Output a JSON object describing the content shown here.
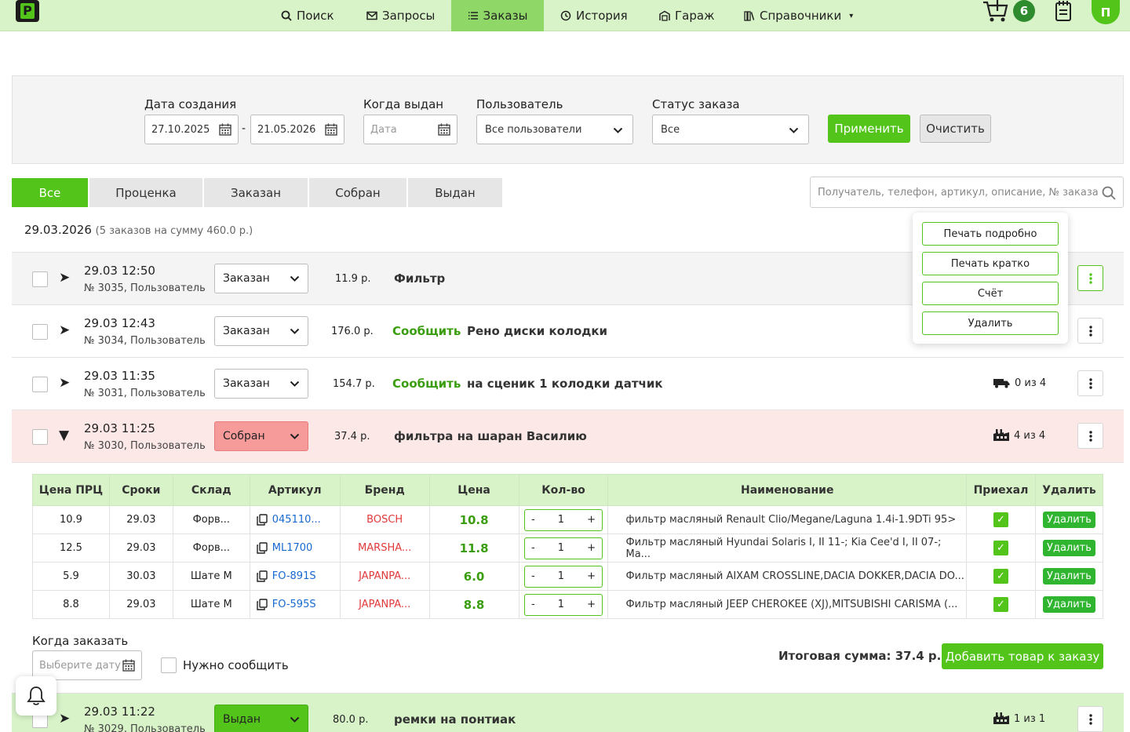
{
  "nav": {
    "logo": "P",
    "items": [
      {
        "label": "Поиск",
        "icon": "search-icon"
      },
      {
        "label": "Запросы",
        "icon": "mail-icon"
      },
      {
        "label": "Заказы",
        "icon": "list-icon"
      },
      {
        "label": "История",
        "icon": "history-icon"
      },
      {
        "label": "Гараж",
        "icon": "garage-icon"
      },
      {
        "label": "Справочники",
        "icon": "book-icon"
      }
    ],
    "dropdown_caret": "▾",
    "cart_count": "6",
    "avatar": "П"
  },
  "filter": {
    "created_label": "Дата создания",
    "date_from": "27.10.2025",
    "date_sep": "-",
    "date_to": "21.05.2026",
    "issued_label": "Когда выдан",
    "issued_placeholder": "Дата",
    "user_label": "Пользователь",
    "user_value": "Все пользователи",
    "status_label": "Статус заказа",
    "status_value": "Все",
    "apply": "Применить",
    "clear": "Очистить"
  },
  "tabs": [
    "Все",
    "Проценка",
    "Заказан",
    "Собран",
    "Выдан"
  ],
  "search_placeholder": "Получатель, телефон, артикул, описание, № заказа",
  "date_group": {
    "date": "29.03.2026",
    "summary": "(5 заказов на сумму 460.0 р.)"
  },
  "popup_menu": [
    "Печать подробно",
    "Печать кратко",
    "Счёт",
    "Удалить"
  ],
  "orders": [
    {
      "arrow": "➤",
      "date": "29.03 12:50",
      "num": "№ 3035, Пользователь",
      "status": "Заказан",
      "sum": "11.9 р.",
      "notify": "",
      "desc": "Фильтр",
      "progress": ""
    },
    {
      "arrow": "➤",
      "date": "29.03 12:43",
      "num": "№ 3034, Пользователь",
      "status": "Заказан",
      "sum": "176.0 р.",
      "notify": "Сообщить",
      "desc": "Рено диски колодки",
      "progress": ""
    },
    {
      "arrow": "➤",
      "date": "29.03 11:35",
      "num": "№ 3031, Пользователь",
      "status": "Заказан",
      "sum": "154.7 р.",
      "notify": "Сообщить",
      "desc": "на сценик 1 колодки датчик",
      "progress": "0 из 4"
    },
    {
      "arrow": "▼",
      "date": "29.03 11:25",
      "num": "№ 3030, Пользователь",
      "status": "Собран",
      "sum": "37.4 р.",
      "notify": "",
      "desc": "фильтра на шаран Василию",
      "progress": "4 из 4"
    },
    {
      "arrow": "➤",
      "date": "29.03 11:22",
      "num": "№ 3029, Пользователь",
      "status": "Выдан",
      "sum": "80.0 р.",
      "notify": "",
      "desc": "ремки на понтиак",
      "progress": "1 из 1"
    }
  ],
  "items_table": {
    "headers": [
      "Цена ПРЦ",
      "Сроки",
      "Склад",
      "Артикул",
      "Бренд",
      "Цена",
      "Кол-во",
      "Наименование",
      "Приехал",
      "Удалить"
    ],
    "rows": [
      {
        "prc": "10.9",
        "term": "29.03",
        "stock": "Форв...",
        "article": "045110...",
        "brand": "BOSCH",
        "price": "10.8",
        "qty": "1",
        "name": "фильтр масляный Renault Clio/Megane/Laguna 1.4i-1.9DTi 95>",
        "arrived": "✓",
        "del": "Удалить"
      },
      {
        "prc": "12.5",
        "term": "29.03",
        "stock": "Форв...",
        "article": "ML1700",
        "brand": "MARSHA...",
        "price": "11.8",
        "qty": "1",
        "name": "Фильтр масляный Hyundai Solaris I, II 11-; Kia Cee'd I, II 07-; Ma...",
        "arrived": "✓",
        "del": "Удалить"
      },
      {
        "prc": "5.9",
        "term": "30.03",
        "stock": "Шате М",
        "article": "FO-891S",
        "brand": "JAPANPA...",
        "price": "6.0",
        "qty": "1",
        "name": "Фильтр масляный AIXAM CROSSLINE,DACIA DOKKER,DACIA DO...",
        "arrived": "✓",
        "del": "Удалить"
      },
      {
        "prc": "8.8",
        "term": "29.03",
        "stock": "Шате М",
        "article": "FO-595S",
        "brand": "JAPANPA...",
        "price": "8.8",
        "qty": "1",
        "name": "Фильтр масляный JEEP CHEROKEE (XJ),MITSUBISHI CARISMA (...",
        "arrived": "✓",
        "del": "Удалить"
      }
    ],
    "qty_minus": "-",
    "qty_plus": "+"
  },
  "order_footer": {
    "when_label": "Когда заказать",
    "date_placeholder": "Выберите дату",
    "notify_label": "Нужно сообщить",
    "total": "Итоговая сумма: 37.4 р.",
    "add_button": "Добавить товар к заказу"
  },
  "colors": {
    "accent": "#52c41a",
    "nav_bg": "#d8f3c8",
    "collected_row": "#fde8e8",
    "collected_select": "#f79a9a",
    "issued_row": "#d8f3c8"
  }
}
